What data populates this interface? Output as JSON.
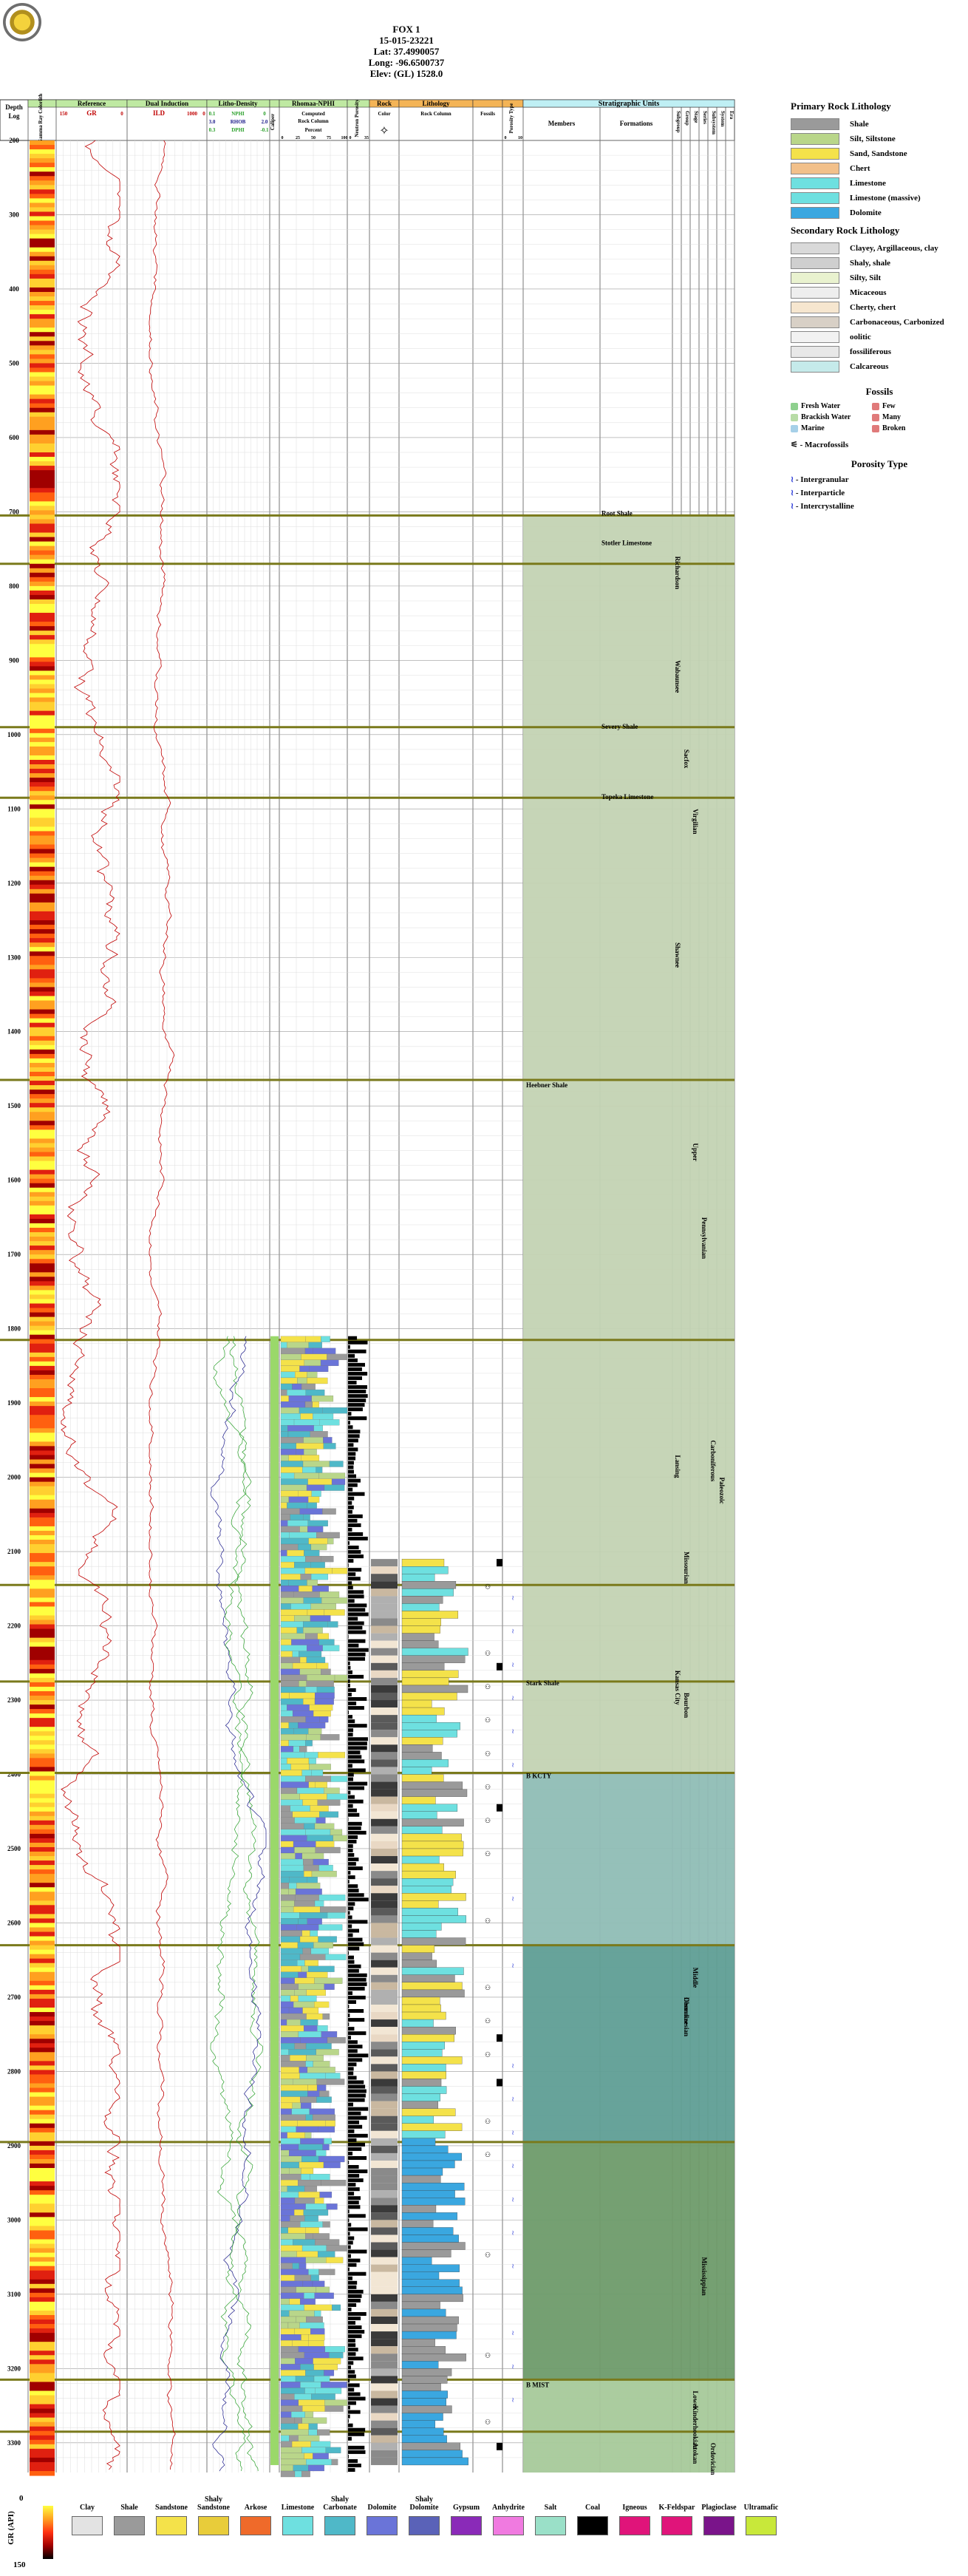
{
  "header": {
    "well_name": "FOX 1",
    "api": "15-015-23221",
    "lat": "Lat: 37.4990057",
    "long": "Long: -96.6500737",
    "elev": "Elev: (GL) 1528.0"
  },
  "tracks": {
    "depth": [
      "Depth",
      "Log"
    ],
    "gamma": "Gamma Ray Colorlith",
    "reference": "Reference",
    "reference_curve": "GR",
    "reference_scale": [
      "150",
      "0"
    ],
    "induction": "Dual Induction",
    "induction_curve": "ILD",
    "induction_scale": [
      "1000",
      "0"
    ],
    "litho": "Litho-Density",
    "litho_curves": [
      {
        "name": "NPHI",
        "scale": [
          "0.1",
          "0"
        ]
      },
      {
        "name": "RHOB",
        "scale": [
          "3.0",
          "2.0"
        ]
      },
      {
        "name": "DPHI",
        "scale": [
          "0.3",
          "-0.1"
        ]
      }
    ],
    "caliper": "Caliper",
    "rhomaa": "Rhomaa-NPHI",
    "rhomaa_sub": [
      "Computed",
      "Rock Column",
      "Percent"
    ],
    "rhomaa_ticks": [
      "0",
      "25",
      "50",
      "75",
      "100"
    ],
    "neutron": "Neutron Porosity",
    "neutron_ticks": [
      "0",
      "35"
    ],
    "rock": "Rock",
    "rock_color": "Color",
    "lithology": "Lithology",
    "lithology_sub": "Rock Column",
    "fossils": "Fossils",
    "porosity_type": "Porosity Type",
    "porosity_ticks": [
      "0",
      "10"
    ],
    "strat": "Stratigraphic Units",
    "members": "Members",
    "formations": "Formations",
    "subgroup": "Subgroup",
    "group": "Group",
    "stage": "Stage",
    "series": "Series",
    "subsystem": "Subsystem",
    "system": "System",
    "era": "Era"
  },
  "depth_ticks": [
    "200",
    "300",
    "400",
    "500",
    "600",
    "700",
    "800",
    "900",
    "1000",
    "1100",
    "1200",
    "1300",
    "1400",
    "1500",
    "1600",
    "1700",
    "1800",
    "1900",
    "2000",
    "2100",
    "2200",
    "2300",
    "2400",
    "2500",
    "2600",
    "2700",
    "2800",
    "2900",
    "3000",
    "3100",
    "3200",
    "3300"
  ],
  "members": [
    {
      "label": "Heebner Shale",
      "depth": 1475
    },
    {
      "label": "Stark Shale",
      "depth": 2280
    },
    {
      "label": "B KCTY",
      "depth": 2405
    },
    {
      "label": "B MIST",
      "depth": 3225
    }
  ],
  "formations": [
    {
      "label": "Root Shale",
      "depth": 705
    },
    {
      "label": "Stotler Limestone",
      "depth": 745
    },
    {
      "label": "Severy Shale",
      "depth": 992
    },
    {
      "label": "Topeka Limestone",
      "depth": 1087
    }
  ],
  "groups": [
    {
      "label": "Richardson",
      "depth": 760
    },
    {
      "label": "Wabaunsee",
      "depth": 900
    },
    {
      "label": "Shawnee",
      "depth": 1280
    },
    {
      "label": "Lansing",
      "depth": 1970
    },
    {
      "label": "Kansas City",
      "depth": 2260
    }
  ],
  "stages": [
    {
      "label": "Sacfox",
      "depth": 1020
    },
    {
      "label": "Missourian",
      "depth": 2100
    },
    {
      "label": "Bourbon",
      "depth": 2290
    },
    {
      "label": "Desmoinesian",
      "depth": 2700
    },
    {
      "label": "Cherokee",
      "depth": 2700
    }
  ],
  "series": [
    {
      "label": "Virgilian",
      "depth": 1100
    },
    {
      "label": "Upper",
      "depth": 1550
    },
    {
      "label": "Middle",
      "depth": 2660
    },
    {
      "label": "Lower",
      "depth": 3230
    },
    {
      "label": "Kinderhookian",
      "depth": 3250
    },
    {
      "label": "Atokan",
      "depth": 3300
    }
  ],
  "subsystems": [
    {
      "label": "Pennsylvanian",
      "depth": 1650
    },
    {
      "label": "Mississippian",
      "depth": 3050
    }
  ],
  "systems": [
    {
      "label": "Carboniferous",
      "depth": 1950
    },
    {
      "label": "Ordovician",
      "depth": 3300
    }
  ],
  "eras": [
    {
      "label": "Paleozoic",
      "depth": 2000
    }
  ],
  "tops": [
    {
      "depth": 705,
      "color": "#7a7a1c"
    },
    {
      "depth": 770,
      "color": "#7a7a1c"
    },
    {
      "depth": 990,
      "color": "#7a7a1c"
    },
    {
      "depth": 1085,
      "color": "#7a7a1c"
    },
    {
      "depth": 1465,
      "color": "#7a7a1c"
    },
    {
      "depth": 1815,
      "color": "#7a7a1c"
    },
    {
      "depth": 2145,
      "color": "#7a7a1c"
    },
    {
      "depth": 2275,
      "color": "#7a7a1c"
    },
    {
      "depth": 2398,
      "color": "#7a7a1c"
    },
    {
      "depth": 2630,
      "color": "#7a7a1c"
    },
    {
      "depth": 2895,
      "color": "#7a7a1c"
    },
    {
      "depth": 3215,
      "color": "#7a7a1c"
    },
    {
      "depth": 3285,
      "color": "#7a7a1c"
    }
  ],
  "strat_fills": [
    {
      "from": 705,
      "to": 2398,
      "color": "#c3d3b3"
    },
    {
      "from": 2398,
      "to": 2630,
      "color": "#8fbdb5"
    },
    {
      "from": 2630,
      "to": 2895,
      "color": "#5f9e95"
    },
    {
      "from": 2895,
      "to": 3215,
      "color": "#6e9b6a"
    },
    {
      "from": 3215,
      "to": 3340,
      "color": "#a6c99a"
    }
  ],
  "legend": {
    "primary_title": "Primary Rock Lithology",
    "primary": [
      {
        "label": "Shale",
        "color": "#9a9a9a"
      },
      {
        "label": "Silt, Siltstone",
        "color": "#b9d68a"
      },
      {
        "label": "Sand, Sandstone",
        "color": "#f4e24a"
      },
      {
        "label": "Chert",
        "color": "#f2c08a"
      },
      {
        "label": "Limestone",
        "color": "#6ee0e0"
      },
      {
        "label": "Limestone (massive)",
        "color": "#6ee0e0"
      },
      {
        "label": "Dolomite",
        "color": "#3aa7e0"
      }
    ],
    "secondary_title": "Secondary Rock Lithology",
    "secondary": [
      {
        "label": "Clayey, Argillaceous, clay",
        "color": "#d9d9d9"
      },
      {
        "label": "Shaly, shale",
        "color": "#cfcfcf"
      },
      {
        "label": "Silty, Silt",
        "color": "#e9f2cf"
      },
      {
        "label": "Micaceous",
        "color": "#eeeeee"
      },
      {
        "label": "Cherty, chert",
        "color": "#f6e6cf"
      },
      {
        "label": "Carbonaceous, Carbonized",
        "color": "#d8d0c6"
      },
      {
        "label": "oolitic",
        "color": "#f2f2f2"
      },
      {
        "label": "fossiliferous",
        "color": "#e8e8e8"
      },
      {
        "label": "Calcareous",
        "color": "#c5eaea"
      }
    ],
    "fossils_title": "Fossils",
    "fossils": [
      {
        "label": "Fresh Water",
        "color": "#8ed08e"
      },
      {
        "label": "Few",
        "color": "#e07a7a"
      },
      {
        "label": "Brackish Water",
        "color": "#b8dca6"
      },
      {
        "label": "Many",
        "color": "#e07a7a"
      },
      {
        "label": "Marine",
        "color": "#a6d0e8"
      },
      {
        "label": "Broken",
        "color": "#e07a7a"
      }
    ],
    "macrofossils": "- Macrofossils",
    "porosity_title": "Porosity Type",
    "porosity": [
      {
        "label": "- Intergranular"
      },
      {
        "label": "- Interparticle"
      },
      {
        "label": "- Intercrystalline"
      }
    ]
  },
  "bottom_legend": {
    "scale_label": "GR (API)",
    "scale_min": "0",
    "scale_max": "150",
    "items": [
      {
        "label": "Clay",
        "color": "#e3e3e3"
      },
      {
        "label": "Shale",
        "color": "#9a9a9a"
      },
      {
        "label": "Sandstone",
        "color": "#f4e24a"
      },
      {
        "label": "Shaly Sandstone",
        "color": "#e8cc3a"
      },
      {
        "label": "Arkose",
        "color": "#ef6a2a"
      },
      {
        "label": "Limestone",
        "color": "#6ee0e0"
      },
      {
        "label": "Shaly Carbonate",
        "color": "#4fb8c8"
      },
      {
        "label": "Dolomite",
        "color": "#6a74d8"
      },
      {
        "label": "Shaly Dolomite",
        "color": "#5a62b8"
      },
      {
        "label": "Gypsum",
        "color": "#8a2ab8"
      },
      {
        "label": "Anhydrite",
        "color": "#f07ae0"
      },
      {
        "label": "Salt",
        "color": "#9ae0c8"
      },
      {
        "label": "Coal",
        "color": "#000000"
      },
      {
        "label": "Igneous",
        "color": "#e0147a"
      },
      {
        "label": "K-Feldspar",
        "color": "#e0147a"
      },
      {
        "label": "Plagioclase",
        "color": "#7a148a"
      },
      {
        "label": "Ultramafic",
        "color": "#c8e83a"
      }
    ]
  }
}
